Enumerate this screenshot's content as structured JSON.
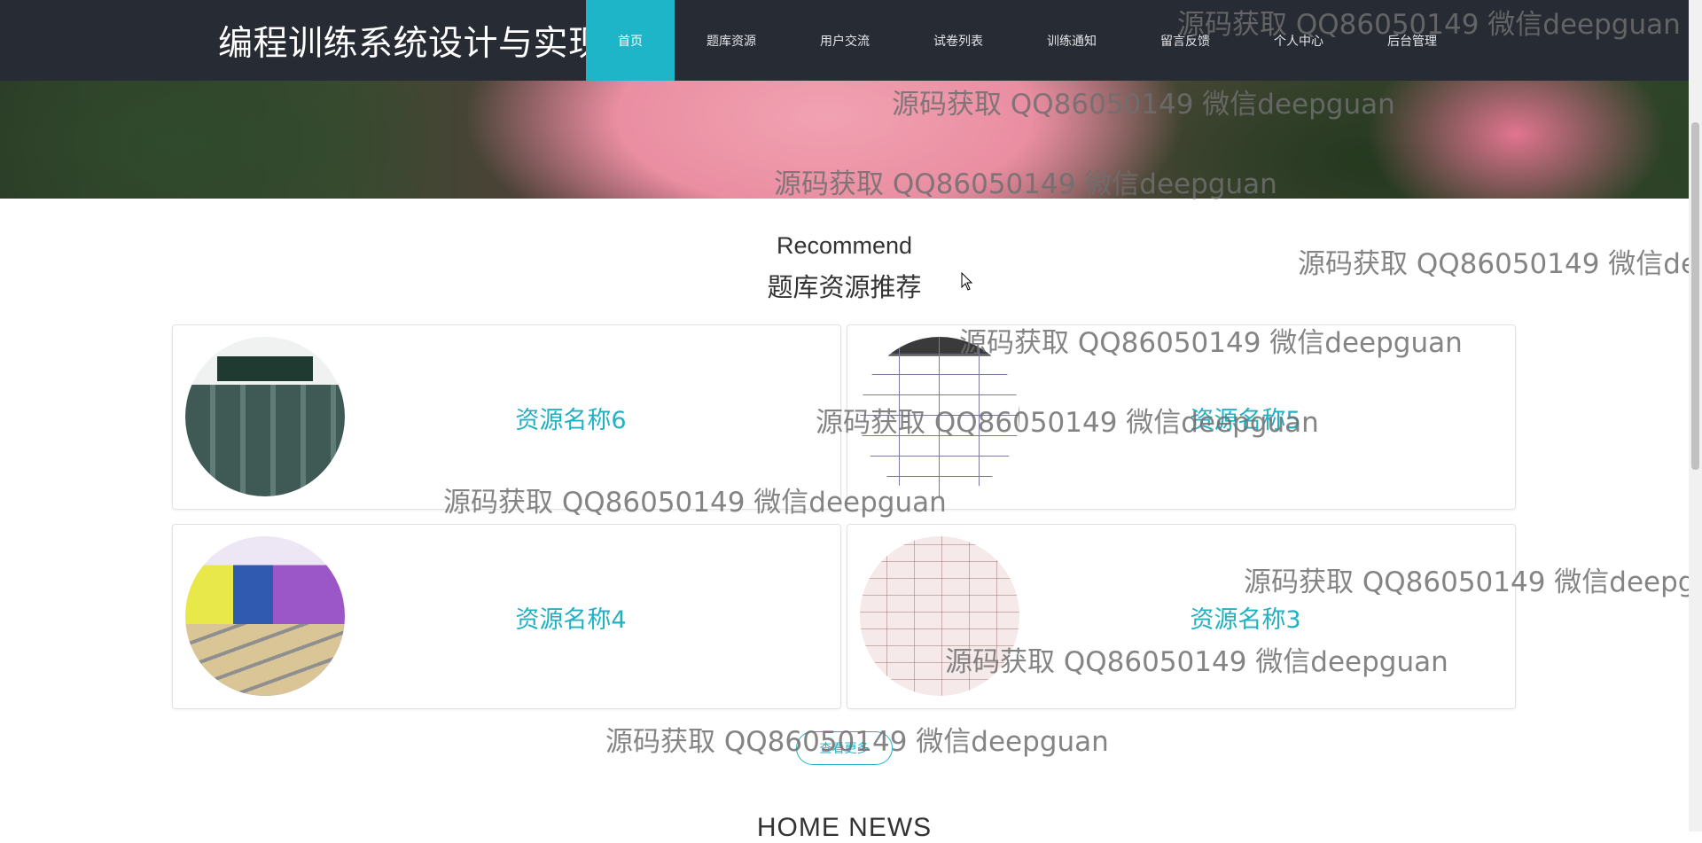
{
  "header": {
    "site_title": "编程训练系统设计与实现",
    "nav": [
      {
        "label": "首页",
        "active": true
      },
      {
        "label": "题库资源"
      },
      {
        "label": "用户交流"
      },
      {
        "label": "试卷列表"
      },
      {
        "label": "训练通知"
      },
      {
        "label": "留言反馈"
      },
      {
        "label": "个人中心"
      },
      {
        "label": "后台管理"
      }
    ],
    "accent_color": "#1fb5c9",
    "bg_color": "#272b33"
  },
  "recommend": {
    "title_en": "Recommend",
    "title_cn": "题库资源推荐",
    "items": [
      {
        "name": "资源名称6",
        "thumb_icon": "lab-classroom-photo"
      },
      {
        "name": "资源名称5",
        "thumb_icon": "function-table-photo"
      },
      {
        "name": "资源名称4",
        "thumb_icon": "colorful-classroom-photo"
      },
      {
        "name": "资源名称3",
        "thumb_icon": "history-chart-photo"
      }
    ],
    "more_label": "查看更多"
  },
  "news": {
    "title": "HOME NEWS"
  },
  "watermark": {
    "text": "源码获取 QQ86050149 微信deepguan",
    "text_cut_1": "源码获取 QQ86050149 微信deep",
    "text_cut_2": "源码获取 QQ86050149 微信deepgua"
  }
}
